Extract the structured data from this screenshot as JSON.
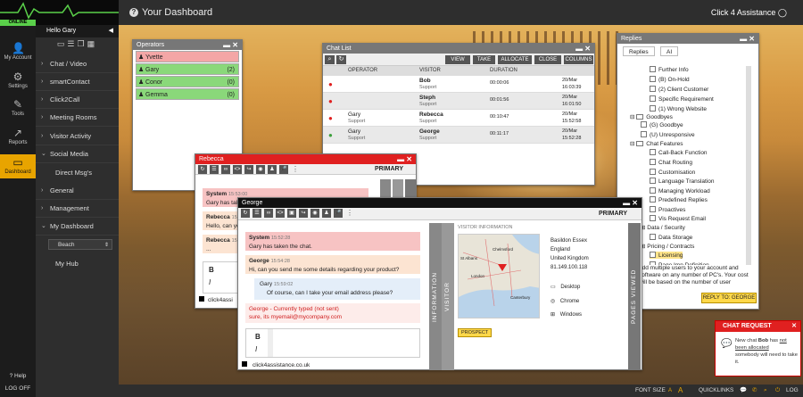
{
  "app": {
    "title": "Your Dashboard",
    "brand": "Click 4 Assistance",
    "status": "ONLINE",
    "user_greeting": "Hello Gary"
  },
  "rail": [
    {
      "label": "My Account"
    },
    {
      "label": "Settings"
    },
    {
      "label": "Tools"
    },
    {
      "label": "Reports"
    },
    {
      "label": "Dashboard"
    }
  ],
  "rail_bottom": {
    "help": "Help",
    "logoff": "LOG OFF"
  },
  "menu": {
    "items": [
      "Chat / Video",
      "smartContact",
      "Click2Call",
      "Meeting Rooms",
      "Visitor Activity",
      "Social Media"
    ],
    "social_sub": "Direct Msg's",
    "items2": [
      "General",
      "Management",
      "My Dashboard"
    ],
    "select_value": "Beach",
    "hub": "My Hub"
  },
  "operators": {
    "title": "Operators",
    "rows": [
      {
        "name": "Yvette",
        "count": "",
        "state": "busy"
      },
      {
        "name": "Gary",
        "count": "(2)",
        "state": "online"
      },
      {
        "name": "Conor",
        "count": "(0)",
        "state": "online"
      },
      {
        "name": "Gemma",
        "count": "(0)",
        "state": "online"
      }
    ]
  },
  "chatlist": {
    "title": "Chat List",
    "buttons": [
      "VIEW",
      "TAKE",
      "ALLOCATE",
      "CLOSE",
      "COLUMNS"
    ],
    "headers": [
      "OPERATOR",
      "VISITOR",
      "DURATION"
    ],
    "rows": [
      {
        "operator": "",
        "visitor": "Bob",
        "dept": "Support",
        "duration": "00:00:06",
        "date": "20/Mar",
        "time": "16:03:39",
        "status": "red"
      },
      {
        "operator": "",
        "visitor": "Steph",
        "dept": "Support",
        "duration": "00:01:56",
        "date": "20/Mar",
        "time": "16:01:50",
        "status": "red"
      },
      {
        "operator": "Gary",
        "visitor": "Rebecca",
        "dept": "Support",
        "duration": "00:10:47",
        "date": "20/Mar",
        "time": "15:52:58",
        "status": "red"
      },
      {
        "operator": "Gary",
        "visitor": "George",
        "dept": "Support",
        "duration": "00:11:17",
        "date": "20/Mar",
        "time": "15:52:28",
        "status": "green"
      }
    ]
  },
  "replies": {
    "title": "Replies",
    "tabs": [
      "Replies",
      "AI"
    ],
    "tree": [
      "Further Info",
      "(B) On-Hold",
      "(2) Client Customer",
      "Specific Requirement",
      "(1) Wrong Website",
      "Goodbyes",
      "(G) Goodbye",
      "(U) Unresponsive",
      "Chat Features",
      "Call-Back Function",
      "Chat Routing",
      "Customisation",
      "Language Translation",
      "Managing Workload",
      "Predefined Replies",
      "Proactives",
      "Vis Request Email",
      "Data / Security",
      "Data Storage",
      "Pricing / Contracts",
      "Licensing",
      "Page Imp Definition"
    ],
    "preview": "add multiple users to your account and software on any number of PC's. Your cost will be based on the number of user",
    "reply_to": "REPLY TO: GEORGE"
  },
  "rebecca": {
    "title": "Rebecca",
    "primary": "PRIMARY",
    "msgs": [
      {
        "who": "System",
        "time": "15:53:00",
        "text": "Gary has taken the chat."
      },
      {
        "who": "Rebecca",
        "time": "15:53:",
        "text": "Hello, can you"
      },
      {
        "who": "Rebecca",
        "time": "15:53:",
        "text": "..."
      }
    ],
    "footer": "click4assi"
  },
  "george": {
    "title": "George",
    "primary": "PRIMARY",
    "msgs": [
      {
        "who": "System",
        "time": "15:52:28",
        "text": "Gary has taken the chat."
      },
      {
        "who": "George",
        "time": "15:54:28",
        "text": "Hi, can you send me some details regarding your product?"
      },
      {
        "who": "Gary",
        "time": "15:59:02",
        "text": "Of course, can I take your email address please?"
      },
      {
        "who": "George",
        "time": "",
        "text": "sure, its myemail@mycompany.com",
        "note": "- Currently typed (not sent)"
      }
    ],
    "footer": "click4assistance.co.uk",
    "side_info": "INFORMATION",
    "side_visitor": "VISITOR",
    "side_pages": "PAGES VIEWED",
    "visitor_info_label": "VISITOR INFORMATION",
    "location": [
      "Basildon Essex",
      "England",
      "United Kingdom",
      "81.149.100.118"
    ],
    "os": "Desktop",
    "browser": "Chrome",
    "platform": "Windows",
    "tag": "PROSPECT",
    "map_labels": {
      "a": "St Albans",
      "b": "Chelmsford",
      "c": "London",
      "d": "Canterbury"
    }
  },
  "chat_request": {
    "title": "CHAT REQUEST",
    "text_pre": "New chat",
    "name": "Bob",
    "text_mid": "has",
    "text_warn": "not been allocated",
    "text_post": "somebody will need to take it."
  },
  "bottombar": {
    "font_size": "FONT SIZE",
    "font_small": "A",
    "font_big": "A",
    "quicklinks": "QUICKLINKS",
    "log": "LOG"
  },
  "colors": {
    "accent": "#e8a400",
    "red": "#e02020",
    "green": "#5ad04a"
  }
}
